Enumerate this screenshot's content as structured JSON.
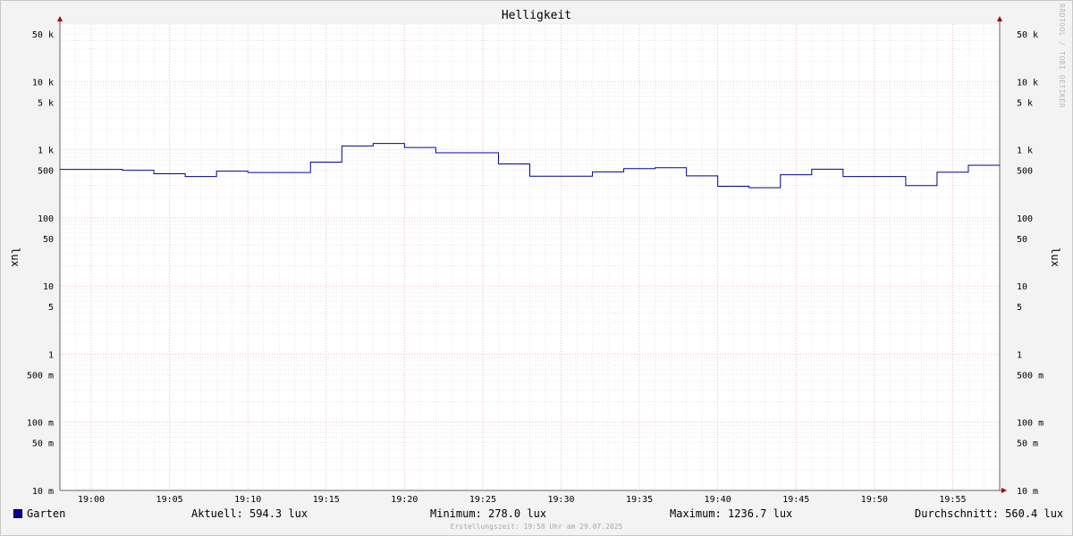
{
  "chart_data": {
    "type": "line",
    "title": "Helligkeit",
    "ylabel": "lux",
    "ylabel_right": "lux",
    "y_scale": "log",
    "ylim": [
      0.01,
      70000
    ],
    "xlim": [
      "18:58",
      "19:58"
    ],
    "grid": true,
    "x_ticks": [
      "19:00",
      "19:05",
      "19:10",
      "19:15",
      "19:20",
      "19:25",
      "19:30",
      "19:35",
      "19:40",
      "19:45",
      "19:50",
      "19:55"
    ],
    "y_ticks": [
      {
        "value": 50000,
        "label": "50 k"
      },
      {
        "value": 10000,
        "label": "10 k"
      },
      {
        "value": 5000,
        "label": "5 k"
      },
      {
        "value": 1000,
        "label": "1 k"
      },
      {
        "value": 500,
        "label": "500"
      },
      {
        "value": 100,
        "label": "100"
      },
      {
        "value": 50,
        "label": "50"
      },
      {
        "value": 10,
        "label": "10"
      },
      {
        "value": 5,
        "label": "5"
      },
      {
        "value": 1,
        "label": "1"
      },
      {
        "value": 0.5,
        "label": "500 m"
      },
      {
        "value": 0.1,
        "label": "100 m"
      },
      {
        "value": 0.05,
        "label": "50 m"
      },
      {
        "value": 0.01,
        "label": "10 m"
      }
    ],
    "series": [
      {
        "name": "Garten",
        "color": "#0000a0",
        "step": true,
        "x": [
          "18:58",
          "19:02",
          "19:04",
          "19:06",
          "19:08",
          "19:10",
          "19:14",
          "19:16",
          "19:18",
          "19:20",
          "19:22",
          "19:26",
          "19:28",
          "19:32",
          "19:34",
          "19:36",
          "19:38",
          "19:40",
          "19:42",
          "19:44",
          "19:46",
          "19:48",
          "19:52",
          "19:54",
          "19:56",
          "19:58"
        ],
        "values": [
          515,
          500,
          445,
          405,
          485,
          465,
          660,
          1140,
          1236.7,
          1080,
          905,
          620,
          410,
          475,
          530,
          545,
          415,
          292,
          278,
          430,
          520,
          405,
          298,
          470,
          594.3,
          594.3
        ]
      }
    ]
  },
  "legend": {
    "series_name": "Garten",
    "current": "Aktuell: 594.3 lux",
    "minimum": "Minimum: 278.0 lux",
    "maximum": "Maximum: 1236.7 lux",
    "average": "Durchschnitt: 560.4 lux"
  },
  "watermark": "RRDTOOL / TOBI OETIKER",
  "created": "Erstellungszeit: 19:58 Uhr am 29.07.2025",
  "colors": {
    "series": "#0000a0",
    "major_grid": "#f0a0a0",
    "minor_grid": "#d8d8d8",
    "background": "#f3f3f3",
    "plot_background": "#ffffff",
    "axis_arrow": "#a00000"
  }
}
